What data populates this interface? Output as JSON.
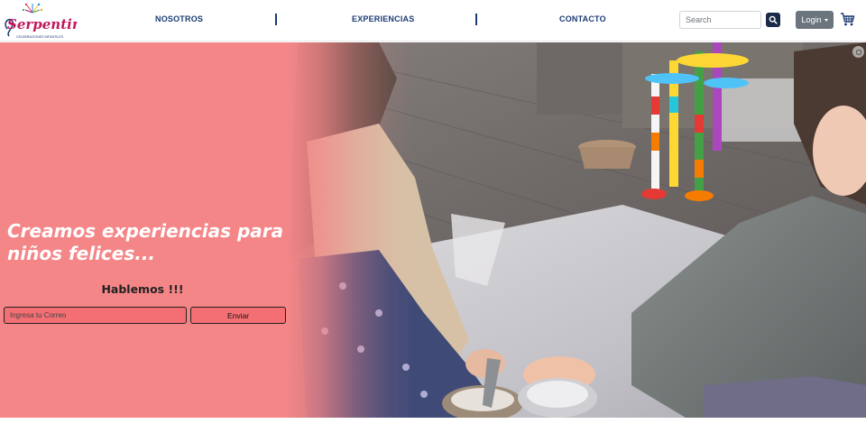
{
  "brand": {
    "logo_text": "Serpentina",
    "logo_tagline": "CELEBRACIONES INFANTILES",
    "brand_color": "#1b3b73",
    "accent_color": "#c2185b"
  },
  "nav": {
    "links": [
      {
        "label": "NOSOTROS"
      },
      {
        "label": "EXPERIENCIAS"
      },
      {
        "label": "CONTACTO"
      }
    ],
    "search": {
      "placeholder": "Search",
      "icon": "search-icon"
    },
    "login": {
      "label": "Login",
      "icon": "chevron-down-icon"
    },
    "cart": {
      "icon": "shopping-cart-icon"
    }
  },
  "hero": {
    "title": "Creamos experiencias para niños felices...",
    "subtitle": "Hablemos !!!",
    "email": {
      "placeholder": "Ingresa tu Correo",
      "value": ""
    },
    "submit_label": "Enviar",
    "overlay_color": "#f48688",
    "form_color": "#f36f74"
  }
}
